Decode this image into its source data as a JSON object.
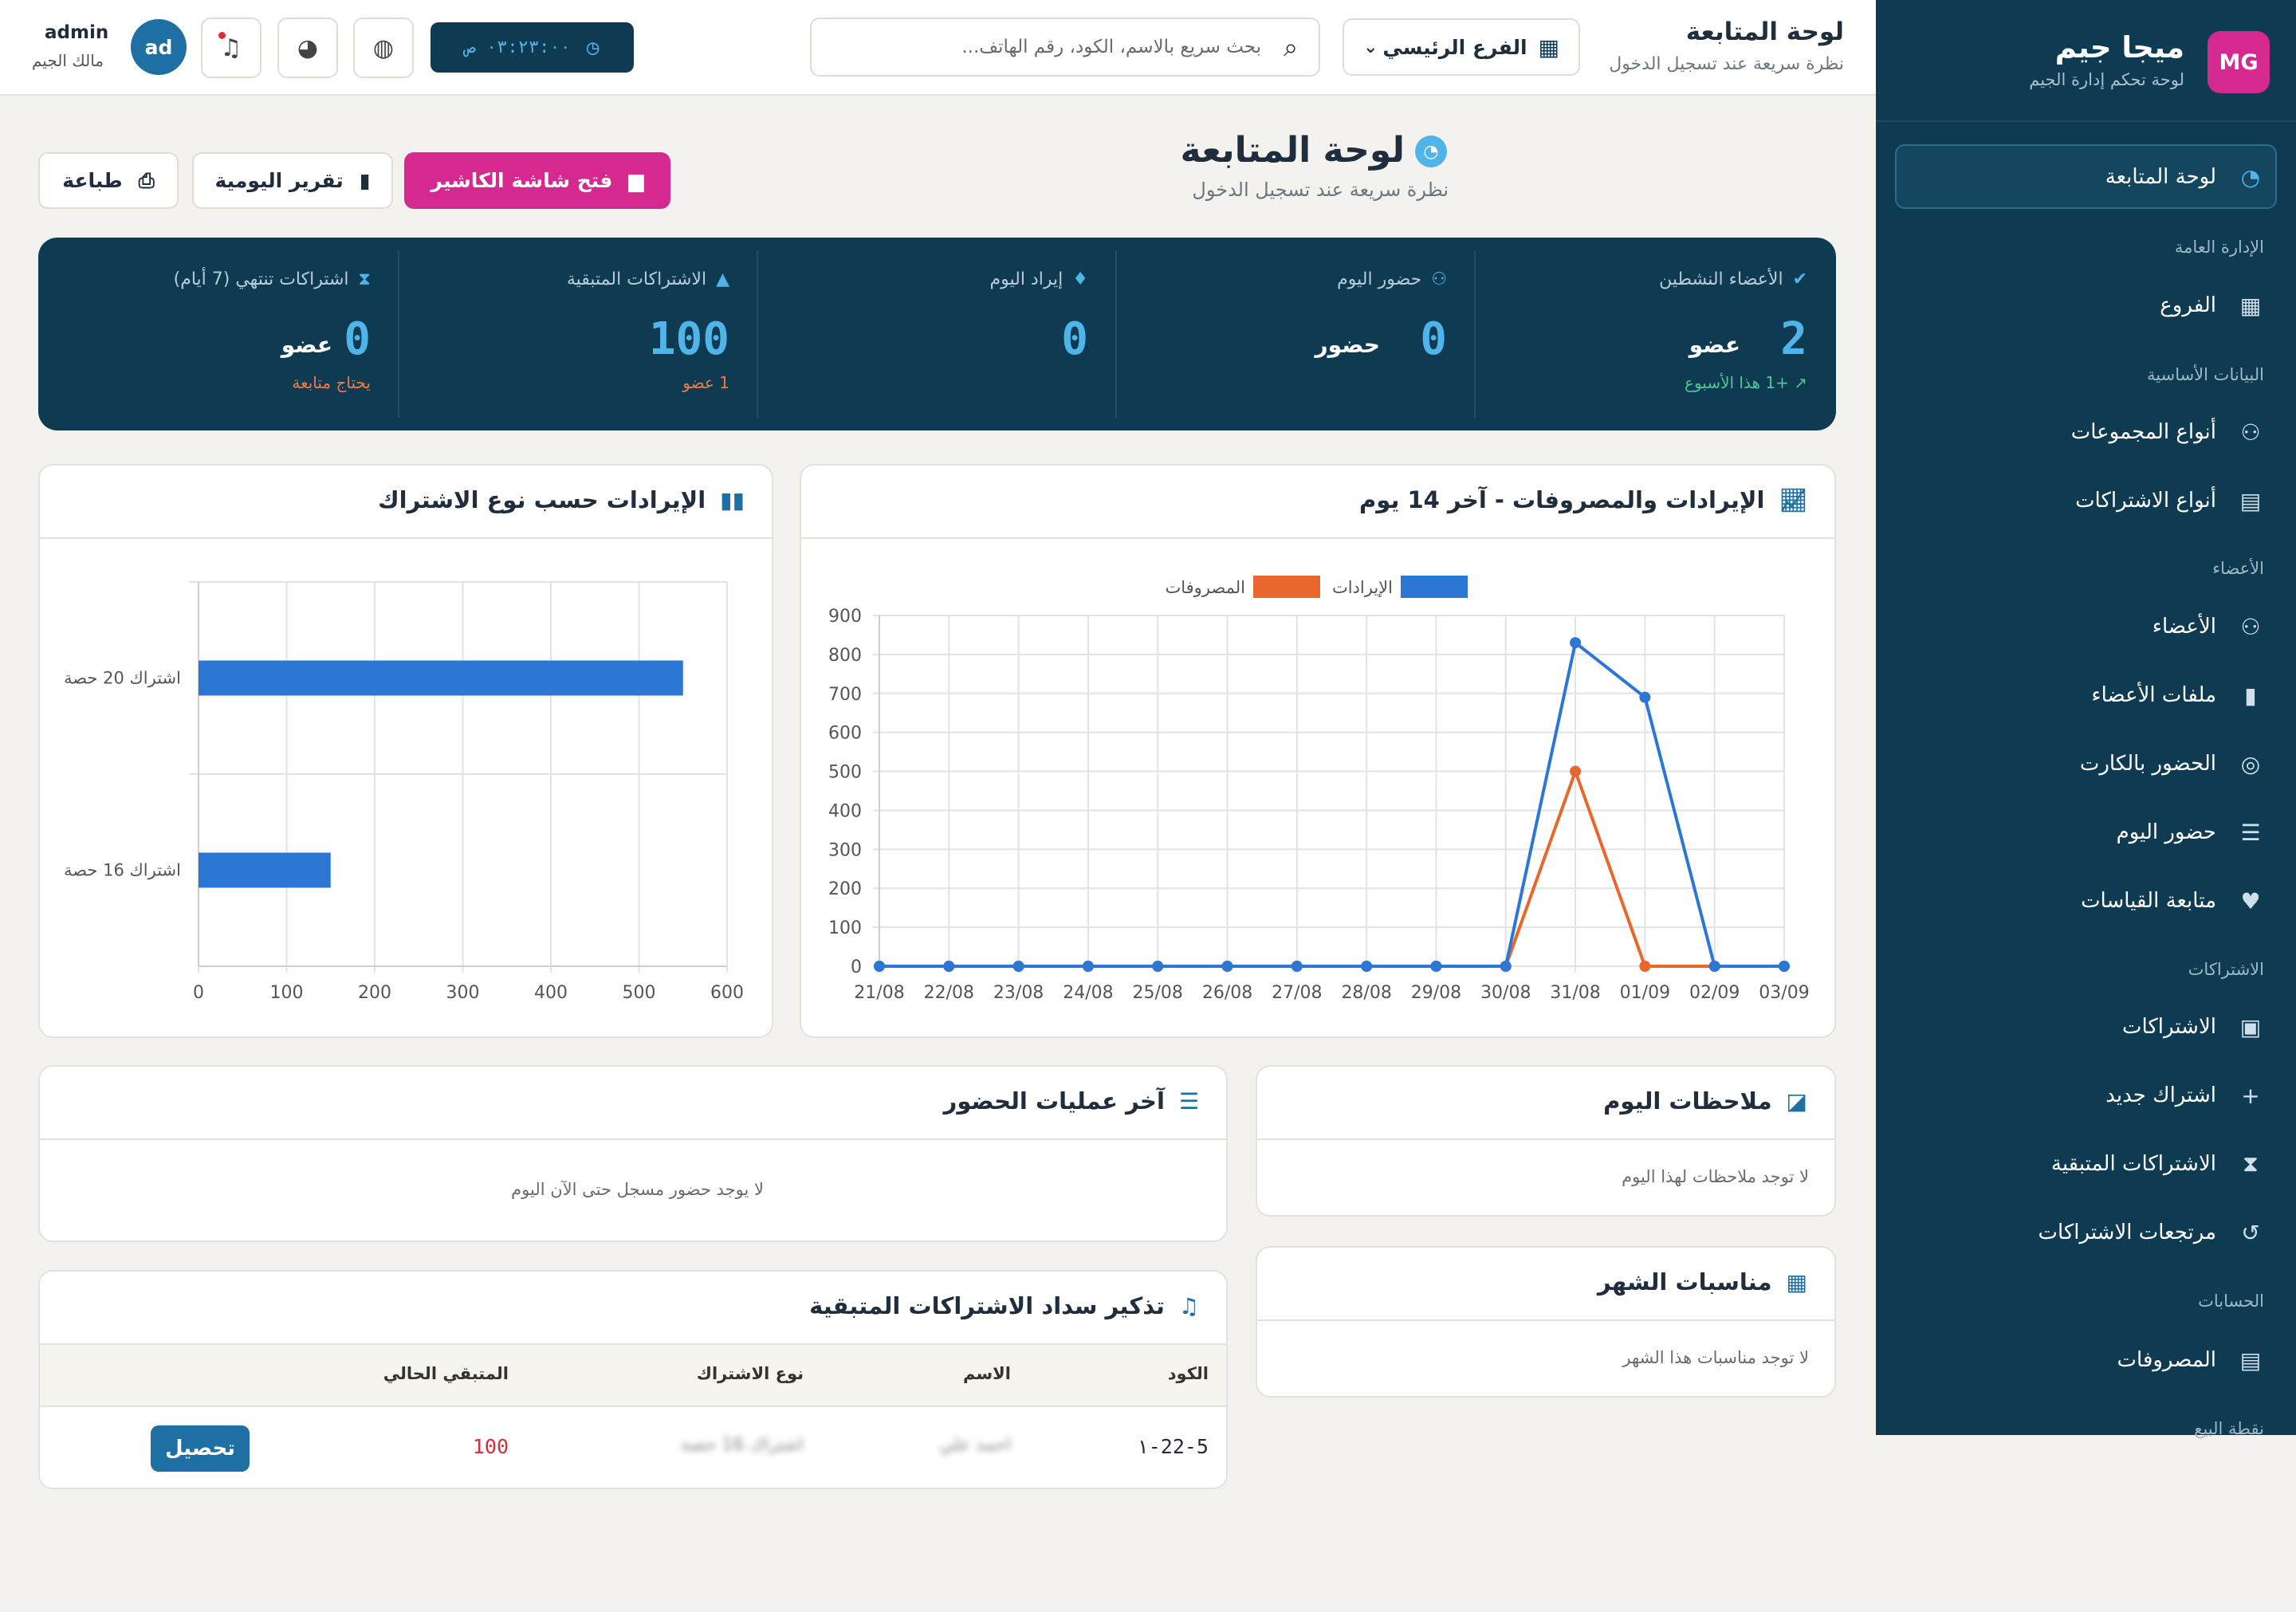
{
  "sidebar": {
    "logo_text": "MG",
    "brand": "ميجا جيم",
    "subtitle": "لوحة تحكم إدارة الجيم",
    "active_item": {
      "label": "لوحة المتابعة",
      "icon": "dashboard-icon"
    },
    "sections": [
      {
        "title": "الإدارة العامة",
        "items": [
          {
            "label": "الفروع",
            "icon": "building-icon"
          }
        ]
      },
      {
        "title": "البيانات الأساسية",
        "items": [
          {
            "label": "أنواع المجموعات",
            "icon": "groups-icon"
          },
          {
            "label": "أنواع الاشتراكات",
            "icon": "id-card-icon"
          }
        ]
      },
      {
        "title": "الأعضاء",
        "items": [
          {
            "label": "الأعضاء",
            "icon": "users-icon"
          },
          {
            "label": "ملفات الأعضاء",
            "icon": "file-icon"
          },
          {
            "label": "الحضور بالكارت",
            "icon": "fingerprint-icon"
          },
          {
            "label": "حضور اليوم",
            "icon": "checklist-icon"
          },
          {
            "label": "متابعة القياسات",
            "icon": "heartbeat-icon"
          }
        ]
      },
      {
        "title": "الاشتراكات",
        "items": [
          {
            "label": "الاشتراكات",
            "icon": "badge-icon"
          },
          {
            "label": "اشتراك جديد",
            "icon": "plus-icon"
          },
          {
            "label": "الاشتراكات المتبقية",
            "icon": "hourglass-icon"
          },
          {
            "label": "مرتجعات الاشتراكات",
            "icon": "undo-icon"
          }
        ]
      },
      {
        "title": "الحسابات",
        "items": [
          {
            "label": "المصروفات",
            "icon": "receipt-icon"
          }
        ]
      },
      {
        "title": "نقطة البيع",
        "items": []
      }
    ]
  },
  "topbar": {
    "title": "لوحة المتابعة",
    "subtitle": "نظرة سريعة عند تسجيل الدخول",
    "branch_label": "الفرع الرئيسي",
    "search_placeholder": "بحث سريع بالاسم، الكود، رقم الهاتف...",
    "clock": "٠٣:٢٣:٠٠ ص",
    "avatar": "ad",
    "user_name": "admin",
    "user_role": "مالك الجيم"
  },
  "page": {
    "title": "لوحة المتابعة",
    "subtitle": "نظرة سريعة عند تسجيل الدخول",
    "open_cashier": "فتح شاشة الكاشير",
    "daily_report": "تقرير اليومية",
    "print": "طباعة"
  },
  "stats": [
    {
      "label": "الأعضاء النشطين",
      "icon": "user-check-icon",
      "value": "2",
      "unit": "عضو",
      "note": "+1 هذا الأسبوع",
      "note_color": "#4cc79a"
    },
    {
      "label": "حضور اليوم",
      "icon": "users-icon",
      "value": "0",
      "unit": "حضور",
      "note": "",
      "note_color": ""
    },
    {
      "label": "إيراد اليوم",
      "icon": "money-bag-icon",
      "value": "0",
      "unit": "",
      "note": "",
      "note_color": ""
    },
    {
      "label": "الاشتراكات المتبقية",
      "icon": "warning-icon",
      "value": "100",
      "unit": "",
      "note": "1 عضو",
      "note_color": "#f07a4a"
    },
    {
      "label": "اشتراكات تنتهي (7 أيام)",
      "icon": "hourglass-icon",
      "value": "0",
      "unit": "عضو",
      "note": "يحتاج متابعة",
      "note_color": "#f07a4a"
    }
  ],
  "revenue_chart_title": "الإيرادات والمصروفات - آخر 14 يوم",
  "type_chart_title": "الإيرادات حسب نوع الاشتراك",
  "chart_data": [
    {
      "type": "line",
      "x": [
        "21/08",
        "22/08",
        "23/08",
        "24/08",
        "25/08",
        "26/08",
        "27/08",
        "28/08",
        "29/08",
        "30/08",
        "31/08",
        "01/09",
        "02/09",
        "03/09"
      ],
      "series": [
        {
          "name": "الإيرادات",
          "color": "#2d77d4",
          "values": [
            0,
            0,
            0,
            0,
            0,
            0,
            0,
            0,
            0,
            0,
            830,
            690,
            0,
            0
          ]
        },
        {
          "name": "المصروفات",
          "color": "#e8672c",
          "values": [
            0,
            0,
            0,
            0,
            0,
            0,
            0,
            0,
            0,
            0,
            500,
            0,
            0,
            0
          ]
        }
      ],
      "ylim": [
        0,
        900
      ],
      "yticks": [
        0,
        100,
        200,
        300,
        400,
        500,
        600,
        700,
        800,
        900
      ],
      "legend": "top",
      "grid": true
    },
    {
      "type": "bar",
      "orientation": "horizontal",
      "categories": [
        "اشتراك 20 حصة",
        "اشتراك 16 حصة"
      ],
      "values": [
        550,
        150
      ],
      "color": "#2d77d4",
      "xlim": [
        0,
        600
      ],
      "xticks": [
        0,
        100,
        200,
        300,
        400,
        500,
        600
      ],
      "grid": true
    }
  ],
  "notes": {
    "title": "ملاحظات اليوم",
    "empty": "لا توجد ملاحظات لهذا اليوم"
  },
  "attendance": {
    "title": "آخر عمليات الحضور",
    "empty": "لا يوجد حضور مسجل حتى الآن اليوم"
  },
  "events": {
    "title": "مناسبات الشهر",
    "empty": "لا توجد مناسبات هذا الشهر"
  },
  "reminders": {
    "title": "تذكير سداد الاشتراكات المتبقية",
    "columns": [
      "الكود",
      "الاسم",
      "نوع الاشتراك",
      "المتبقي الحالي"
    ],
    "rows": [
      {
        "code": "22-5-١",
        "name": "احمد علي",
        "type": "اشتراك 16 حصة",
        "remaining": "100",
        "action": "تحصيل"
      }
    ]
  }
}
